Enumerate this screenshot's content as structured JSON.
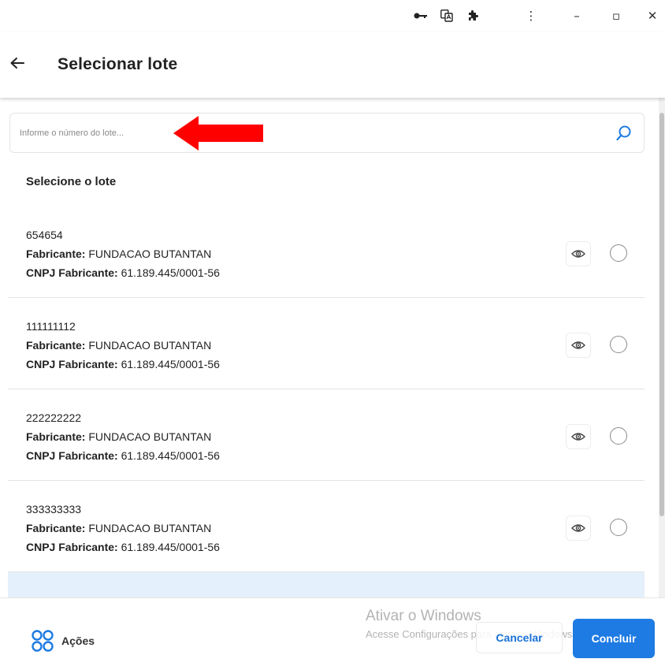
{
  "browser": {
    "extension_icons": [
      "key-icon",
      "translate-icon",
      "puzzle-icon",
      "kebab-menu-icon"
    ],
    "window_controls": [
      "minimize-icon",
      "restore-icon",
      "close-icon"
    ],
    "glyphs": {
      "minimize": "–",
      "restore": "▫",
      "close": "✕",
      "kebab": "⋮"
    }
  },
  "header": {
    "title": "Selecionar lote",
    "back_icon": "arrow-left-icon"
  },
  "search": {
    "placeholder": "Informe o número do lote...",
    "value": "",
    "icon": "search-icon"
  },
  "list": {
    "title": "Selecione o lote",
    "fabricante_label": "Fabricante:",
    "cnpj_label": "CNPJ Fabricante:",
    "items": [
      {
        "lot": "654654",
        "fabricante": "FUNDACAO BUTANTAN",
        "cnpj": "61.189.445/0001-56",
        "selected": false
      },
      {
        "lot": "111111112",
        "fabricante": "FUNDACAO BUTANTAN",
        "cnpj": "61.189.445/0001-56",
        "selected": false
      },
      {
        "lot": "222222222",
        "fabricante": "FUNDACAO BUTANTAN",
        "cnpj": "61.189.445/0001-56",
        "selected": false
      },
      {
        "lot": "333333333",
        "fabricante": "FUNDACAO BUTANTAN",
        "cnpj": "61.189.445/0001-56",
        "selected": false
      }
    ]
  },
  "footer": {
    "actions_label": "Ações",
    "actions_icon": "grid-icon",
    "cancel_label": "Cancelar",
    "confirm_label": "Concluir",
    "watermark_title": "Ativar o Windows",
    "watermark_sub": "Acesse Configurações para ativar o Windows."
  },
  "colors": {
    "primary": "#1e7be3",
    "selected_row": "#e4f0fb",
    "annotation_arrow": "#ff0000"
  }
}
